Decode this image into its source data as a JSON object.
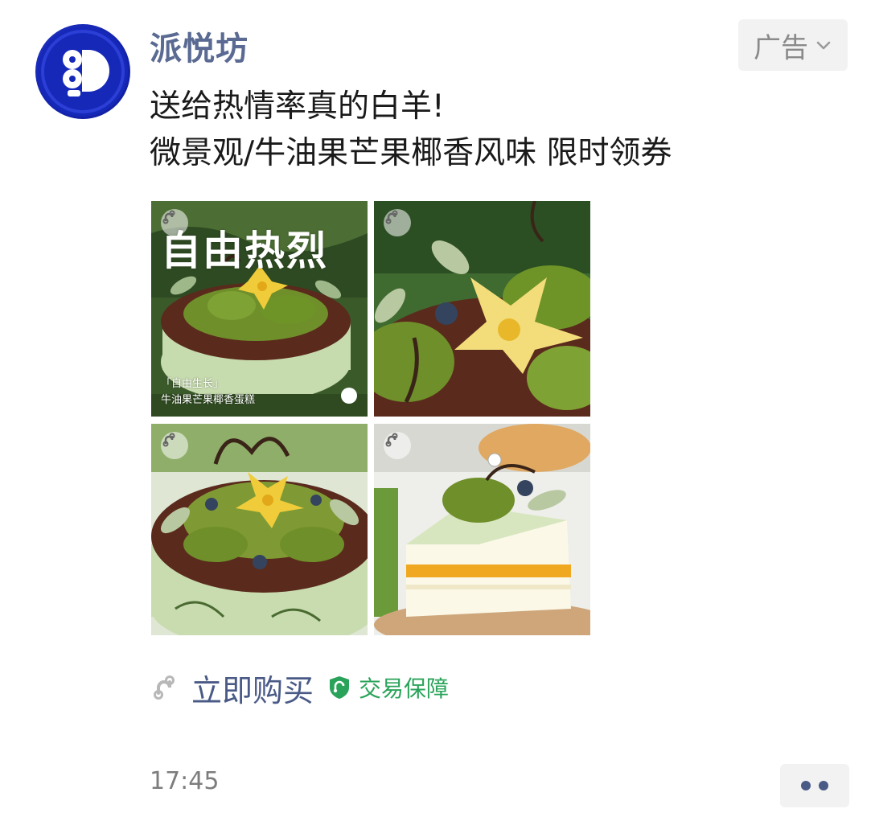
{
  "post": {
    "account_name": "派悦坊",
    "ad_label": "广告",
    "caption_line1": "送给热情率真的白羊!",
    "caption_line2": "微景观/牛油果芒果椰香风味 限时领券",
    "time": "17:45"
  },
  "images": [
    {
      "headline": "自由热烈",
      "sub1": "「自由生长」",
      "sub2": "牛油果芒果椰香蛋糕"
    },
    {},
    {},
    {}
  ],
  "action": {
    "buy_label": "立即购买",
    "guarantee_label": "交易保障"
  },
  "colors": {
    "account_name": "#5a6a92",
    "buy_label": "#4a5a86",
    "guarantee": "#2aa35a",
    "avatar_bg": "#1424b0"
  },
  "icons": {
    "ad_tag": "chevron-down-icon",
    "image_badge": "mini-program-link-icon",
    "buy": "mini-program-link-icon",
    "guarantee": "shield-check-icon",
    "more": "more-dots-icon"
  }
}
